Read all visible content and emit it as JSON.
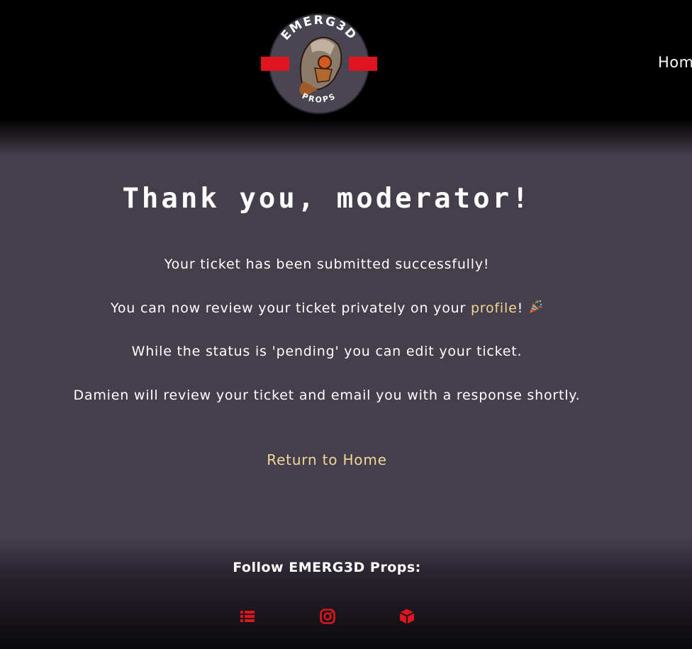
{
  "header": {
    "logo": {
      "name": "emerg3d-props-logo",
      "top_text": "EMERG3D",
      "bottom_text": "PROPS",
      "colors": {
        "ring": "#4a4552",
        "band": "#e0141e"
      }
    },
    "nav": {
      "home_label": "Home"
    }
  },
  "main": {
    "title": "Thank you, moderator!",
    "line1": "Your ticket has been submitted successfully!",
    "line2_prefix": "You can now review your ticket privately on your ",
    "line2_link": "profile",
    "line2_suffix": "!",
    "line2_emoji": "party-popper-icon",
    "line3": "While the status is 'pending' you can edit your ticket.",
    "line4": "Damien will review your ticket and email you with a response shortly.",
    "return_link": "Return to Home"
  },
  "footer": {
    "follow_label": "Follow EMERG3D Props:",
    "social": [
      {
        "icon": "list-icon"
      },
      {
        "icon": "instagram-icon"
      },
      {
        "icon": "cube-icon"
      }
    ]
  },
  "colors": {
    "background": "#453f4c",
    "header": "#000000",
    "link": "#f3d59a",
    "accent": "#e0141e"
  }
}
